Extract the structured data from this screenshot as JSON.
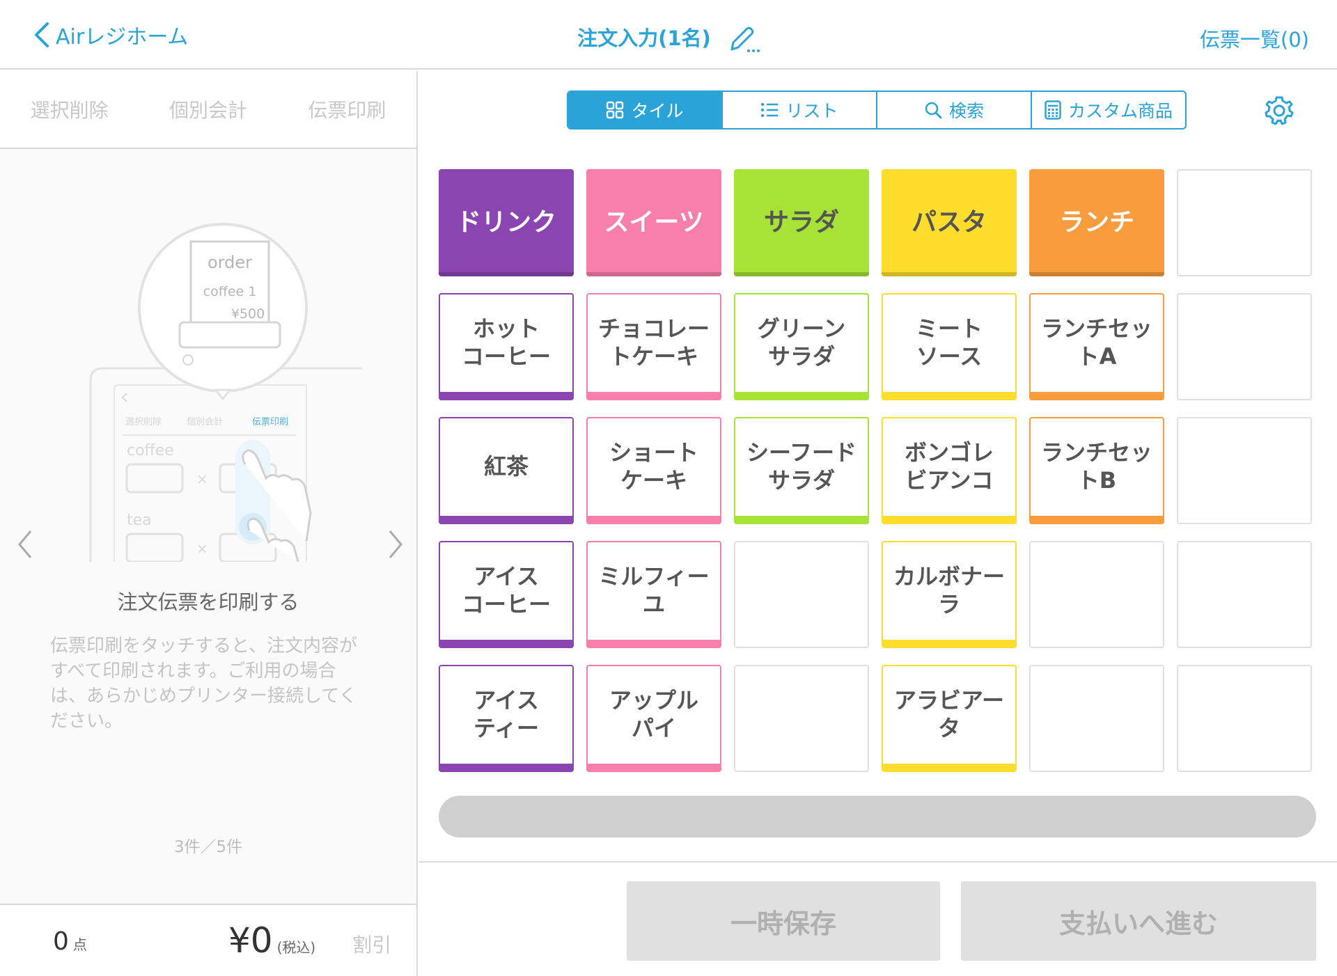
{
  "header": {
    "back_label": "Airレジホーム",
    "title": "注文入力(1名)",
    "slips_label": "伝票一覧(0)"
  },
  "left_actions": [
    "選択削除",
    "個別会計",
    "伝票印刷"
  ],
  "illustration": {
    "receipt": [
      "order",
      "coffee 1",
      "¥500"
    ],
    "tabs": [
      "選択削除",
      "個別会計",
      "伝票印刷"
    ],
    "items": [
      "coffee",
      "tea"
    ]
  },
  "tutorial": {
    "title": "注文伝票を印刷する",
    "body": "伝票印刷をタッチすると、注文内容がすべて印刷されます。ご利用の場合は、あらかじめプリンター接続してください。",
    "pager": "3件／5件"
  },
  "summary": {
    "count": "0",
    "count_unit": "点",
    "total": "¥0",
    "tax_note": "(税込)",
    "discount_label": "割引"
  },
  "view_tabs": [
    {
      "label": "タイル",
      "icon": "grid-icon",
      "active": true
    },
    {
      "label": "リスト",
      "icon": "list-icon",
      "active": false
    },
    {
      "label": "検索",
      "icon": "search-icon",
      "active": false
    },
    {
      "label": "カスタム商品",
      "icon": "calculator-icon",
      "active": false
    }
  ],
  "colors": {
    "accent": "#29a3d8",
    "drink": "#8a45b0",
    "sweets": "#f97fab",
    "salad": "#a7e236",
    "pasta": "#ffdd2c",
    "lunch": "#f89c3e"
  },
  "categories": [
    "ドリンク",
    "スイーツ",
    "サラダ",
    "パスタ",
    "ランチ"
  ],
  "menu_columns": [
    [
      "ホットコーヒー",
      "紅茶",
      "アイスコーヒー",
      "アイスティー"
    ],
    [
      "チョコレートケーキ",
      "ショートケーキ",
      "ミルフィーユ",
      "アップルパイ"
    ],
    [
      "グリーンサラダ",
      "シーフードサラダ"
    ],
    [
      "ミートソース",
      "ボンゴレビアンコ",
      "カルボナーラ",
      "アラビアータ"
    ],
    [
      "ランチセットA",
      "ランチセットB"
    ]
  ],
  "tile_labels": {
    "r1c1": "ホット\nコーヒー",
    "r1c2": "チョコレー\nトケーキ",
    "r1c3": "グリーン\nサラダ",
    "r1c4": "ミート\nソース",
    "r1c5": "ランチセッ\nトA",
    "r2c1": "紅茶",
    "r2c2": "ショート\nケーキ",
    "r2c3": "シーフード\nサラダ",
    "r2c4": "ボンゴレ\nビアンコ",
    "r2c5": "ランチセッ\nトB",
    "r3c1": "アイス\nコーヒー",
    "r3c2": "ミルフィー\nユ",
    "r3c4": "カルボナー\nラ",
    "r4c1": "アイス\nティー",
    "r4c2": "アップル\nパイ",
    "r4c4": "アラビアー\nタ"
  },
  "buttons": {
    "save": "一時保存",
    "pay": "支払いへ進む"
  }
}
